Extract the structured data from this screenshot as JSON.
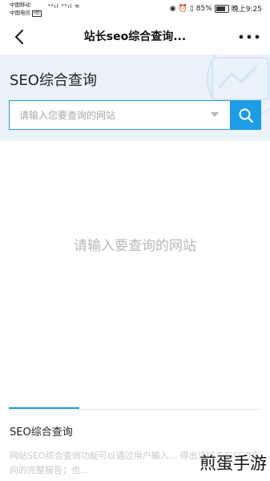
{
  "status_bar": {
    "carrier1": "中国移动",
    "carrier2": "中国电信",
    "network_badge": "HD",
    "signal1": "⁴⁶ıl",
    "signal2": "⁴⁶ıl",
    "battery_percent": "85%",
    "time": "晚上9:25"
  },
  "nav": {
    "title": "站长seo综合查询..."
  },
  "header": {
    "heading": "SEO综合查询",
    "search_placeholder": "请输入您要查询的网站"
  },
  "main": {
    "empty_hint": "请输入要查询的网站"
  },
  "section": {
    "title": "SEO综合查询",
    "description": "网站SEO综合查询功能可以通过用户输入... 得出该域名在SEO方向的完整报告；也..."
  },
  "watermark": "煎蛋手游",
  "colors": {
    "accent": "#1e9ce6",
    "header_bg": "#eaf2fa"
  }
}
